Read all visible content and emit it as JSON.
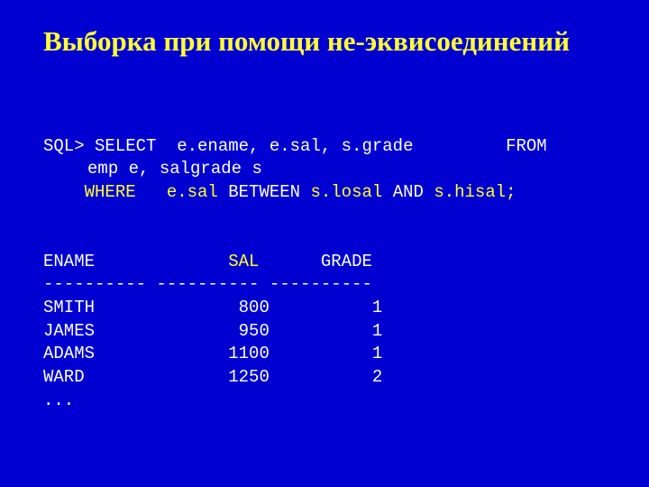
{
  "title": "Выборка при помощи не-эквисоединений",
  "sql": {
    "l1a": "SQL> SELECT  e.ename, e.sal, s.grade         FROM",
    "l2": "emp e, salgrade s",
    "l3a": "    ",
    "l3b": "WHERE   e.sal",
    "l3c": " BETWEEN ",
    "l3d": "s.losal",
    "l3e": " AND ",
    "l3f": "s.hisal;"
  },
  "result": {
    "hdr_ename": "ENAME             ",
    "hdr_sal": "SAL",
    "hdr_grade": "      GRADE",
    "divider": "---------- ---------- ----------",
    "rows": [
      "SMITH              800          1",
      "JAMES              950          1",
      "ADAMS             1100          1",
      "WARD              1250          2",
      "..."
    ]
  }
}
